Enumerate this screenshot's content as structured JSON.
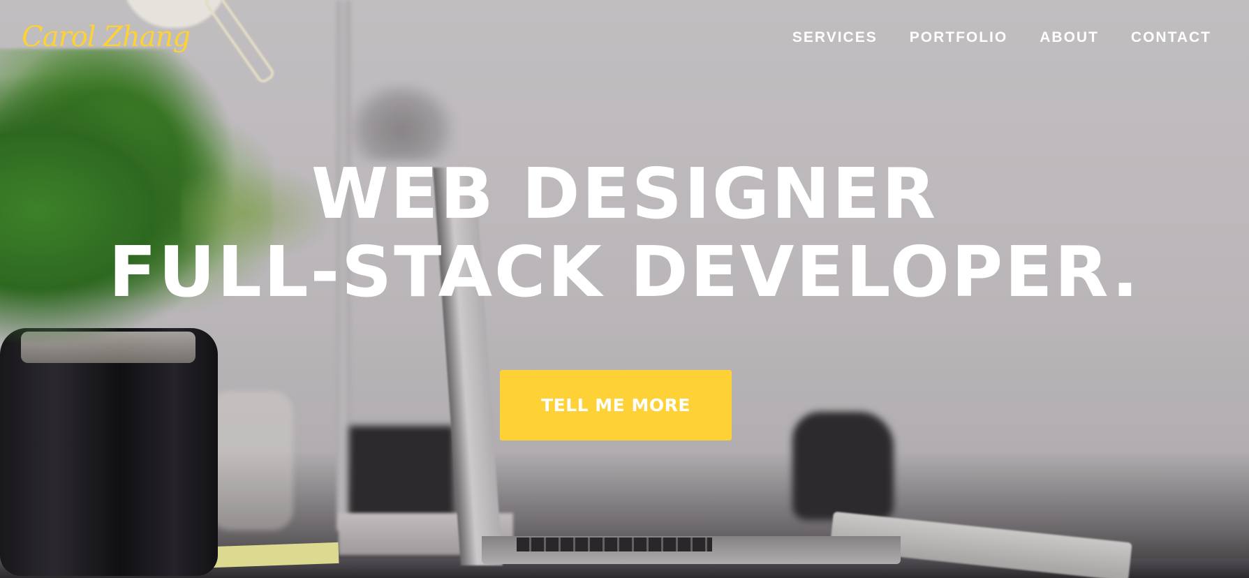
{
  "brand": {
    "name": "Carol Zhang",
    "color": "#fed136"
  },
  "nav": {
    "items": [
      {
        "label": "SERVICES"
      },
      {
        "label": "PORTFOLIO"
      },
      {
        "label": "ABOUT"
      },
      {
        "label": "CONTACT"
      }
    ]
  },
  "hero": {
    "line1": "WEB DESIGNER",
    "line2": "FULL-STACK DEVELOPER.",
    "cta_label": "TELL ME MORE",
    "cta_color": "#fed136",
    "text_color": "#ffffff"
  }
}
